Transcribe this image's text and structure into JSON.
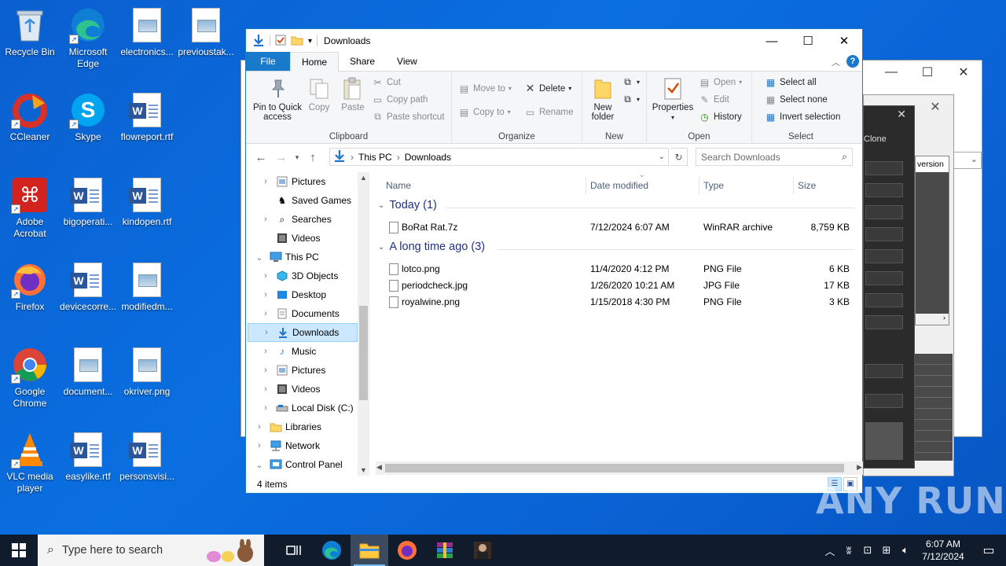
{
  "desktop": {
    "icons": [
      {
        "label": "Recycle Bin"
      },
      {
        "label": "Microsoft Edge"
      },
      {
        "label": "electronics..."
      },
      {
        "label": "previoustak..."
      },
      {
        "label": "CCleaner"
      },
      {
        "label": "Skype"
      },
      {
        "label": "flowreport.rtf"
      },
      {
        "label": "Adobe Acrobat"
      },
      {
        "label": "bigoperati..."
      },
      {
        "label": "kindopen.rtf"
      },
      {
        "label": "Firefox"
      },
      {
        "label": "devicecorre..."
      },
      {
        "label": "modifiedm..."
      },
      {
        "label": "Google Chrome"
      },
      {
        "label": "document..."
      },
      {
        "label": "okriver.png"
      },
      {
        "label": "VLC media player"
      },
      {
        "label": "easylike.rtf"
      },
      {
        "label": "personsvisi..."
      }
    ]
  },
  "background_windows": {
    "dark_window": {
      "clone_label": "Clone",
      "version_label": "version"
    }
  },
  "explorer": {
    "title": "Downloads",
    "tabs": {
      "file": "File",
      "home": "Home",
      "share": "Share",
      "view": "View"
    },
    "ribbon": {
      "clipboard": {
        "label": "Clipboard",
        "pin": "Pin to Quick access",
        "copy": "Copy",
        "paste": "Paste",
        "cut": "Cut",
        "copy_path": "Copy path",
        "paste_shortcut": "Paste shortcut"
      },
      "organize": {
        "label": "Organize",
        "move_to": "Move to",
        "copy_to": "Copy to",
        "delete": "Delete",
        "rename": "Rename"
      },
      "new": {
        "label": "New",
        "new_folder": "New folder"
      },
      "open": {
        "label": "Open",
        "properties": "Properties",
        "open": "Open",
        "edit": "Edit",
        "history": "History"
      },
      "select": {
        "label": "Select",
        "select_all": "Select all",
        "select_none": "Select none",
        "invert": "Invert selection"
      }
    },
    "address": {
      "this_pc": "This PC",
      "downloads": "Downloads"
    },
    "search_placeholder": "Search Downloads",
    "nav": [
      {
        "label": "Pictures",
        "indent": 1
      },
      {
        "label": "Saved Games",
        "indent": 1
      },
      {
        "label": "Searches",
        "indent": 1
      },
      {
        "label": "Videos",
        "indent": 1
      },
      {
        "label": "This PC",
        "indent": 0
      },
      {
        "label": "3D Objects",
        "indent": 1
      },
      {
        "label": "Desktop",
        "indent": 1
      },
      {
        "label": "Documents",
        "indent": 1
      },
      {
        "label": "Downloads",
        "indent": 1
      },
      {
        "label": "Music",
        "indent": 1
      },
      {
        "label": "Pictures",
        "indent": 1
      },
      {
        "label": "Videos",
        "indent": 1
      },
      {
        "label": "Local Disk (C:)",
        "indent": 1
      },
      {
        "label": "Libraries",
        "indent": 0
      },
      {
        "label": "Network",
        "indent": 0
      },
      {
        "label": "Control Panel",
        "indent": 0
      }
    ],
    "columns": {
      "name": "Name",
      "date": "Date modified",
      "type": "Type",
      "size": "Size"
    },
    "groups": [
      {
        "title": "Today (1)",
        "files": [
          {
            "name": "BoRat Rat.7z",
            "date": "7/12/2024 6:07 AM",
            "type": "WinRAR archive",
            "size": "8,759 KB"
          }
        ]
      },
      {
        "title": "A long time ago (3)",
        "files": [
          {
            "name": "lotco.png",
            "date": "11/4/2020 4:12 PM",
            "type": "PNG File",
            "size": "6 KB"
          },
          {
            "name": "periodcheck.jpg",
            "date": "1/26/2020 10:21 AM",
            "type": "JPG File",
            "size": "17 KB"
          },
          {
            "name": "royalwine.png",
            "date": "1/15/2018 4:30 PM",
            "type": "PNG File",
            "size": "3 KB"
          }
        ]
      }
    ],
    "status": "4 items"
  },
  "taskbar": {
    "search_placeholder": "Type here to search",
    "time": "6:07 AM",
    "date": "7/12/2024"
  },
  "watermark": "ANY RUN",
  "colors": {
    "accent": "#1979ca",
    "taskbar": "#101c2c",
    "selection": "#cce8ff"
  }
}
